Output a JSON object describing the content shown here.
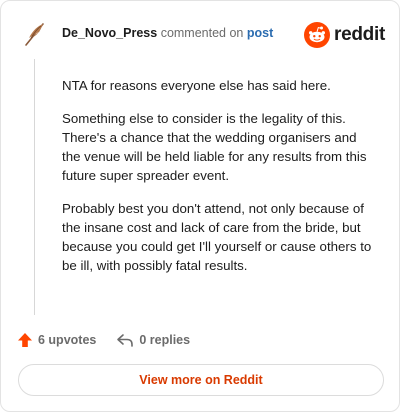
{
  "header": {
    "username": "De_Novo_Press",
    "action_text": "commented on",
    "post_link": "post",
    "brand_name": "reddit",
    "brand_color": "#ff4500",
    "avatar_icon": "quill-feather-icon"
  },
  "comment": {
    "paragraphs": [
      "NTA for reasons everyone else has said here.",
      "Something else to consider is the legality of this. There's a chance that the wedding organisers and the venue will be held liable for any results from this future super spreader event.",
      "Probably best you don't attend, not only because of the insane cost and lack of care from the bride, but because you could get I'll yourself or cause others to be ill, with possibly fatal results."
    ]
  },
  "actions": {
    "upvotes_label": "6 upvotes",
    "replies_label": "0 replies",
    "upvote_color": "#ff4500"
  },
  "footer": {
    "view_more_label": "View more on Reddit",
    "view_more_color": "#d93a00"
  }
}
